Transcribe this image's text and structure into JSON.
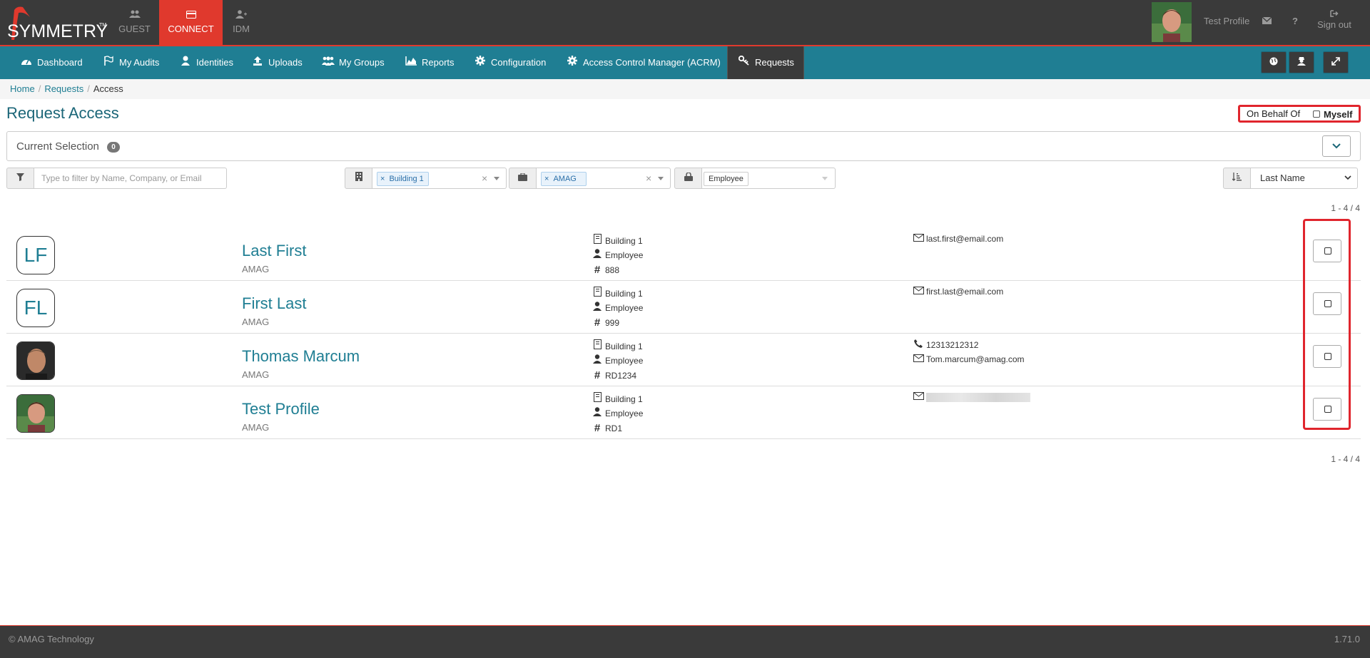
{
  "brand": {
    "logo_text": "SYMMETRY",
    "tm": "TM"
  },
  "modules": [
    {
      "label": "GUEST"
    },
    {
      "label": "CONNECT"
    },
    {
      "label": "IDM"
    }
  ],
  "user": {
    "name": "Test Profile",
    "signout_label": "Sign out",
    "help": "?"
  },
  "nav": {
    "items": [
      {
        "label": "Dashboard"
      },
      {
        "label": "My Audits"
      },
      {
        "label": "Identities"
      },
      {
        "label": "Uploads"
      },
      {
        "label": "My Groups"
      },
      {
        "label": "Reports"
      },
      {
        "label": "Configuration"
      },
      {
        "label": "Access Control Manager (ACRM)"
      },
      {
        "label": "Requests"
      }
    ]
  },
  "breadcrumb": {
    "home": "Home",
    "requests": "Requests",
    "current": "Access",
    "sep": "/"
  },
  "page": {
    "title": "Request Access",
    "on_behalf_label": "On Behalf Of",
    "myself_label": "Myself",
    "current_selection_label": "Current Selection",
    "current_selection_count": "0"
  },
  "filters": {
    "search_placeholder": "Type to filter by Name, Company, or Email",
    "building_tag": "Building 1",
    "company_tag": "AMAG",
    "type_value": "Employee",
    "sort_value": "Last Name",
    "tag_remove": "×",
    "clear": "×"
  },
  "pager": {
    "top": "1 - 4 / 4",
    "bottom": "1 - 4 / 4"
  },
  "people": [
    {
      "initials": "LF",
      "name": "Last First",
      "company": "AMAG",
      "building": "Building 1",
      "type": "Employee",
      "number": "888",
      "phone": "",
      "email": "last.first@email.com"
    },
    {
      "initials": "FL",
      "name": "First Last",
      "company": "AMAG",
      "building": "Building 1",
      "type": "Employee",
      "number": "999",
      "phone": "",
      "email": "first.last@email.com"
    },
    {
      "initials": "",
      "name": "Thomas Marcum",
      "company": "AMAG",
      "building": "Building 1",
      "type": "Employee",
      "number": "RD1234",
      "phone": "12313212312",
      "email": "Tom.marcum@amag.com"
    },
    {
      "initials": "",
      "name": "Test Profile",
      "company": "AMAG",
      "building": "Building 1",
      "type": "Employee",
      "number": "RD1",
      "phone": "",
      "email": ""
    }
  ],
  "footer": {
    "copyright": "© AMAG Technology",
    "version": "1.71.0"
  },
  "colors": {
    "header": "#3a3a3a",
    "accent_red": "#e0392d",
    "nav": "#1f7e93",
    "link": "#1f7e93"
  }
}
